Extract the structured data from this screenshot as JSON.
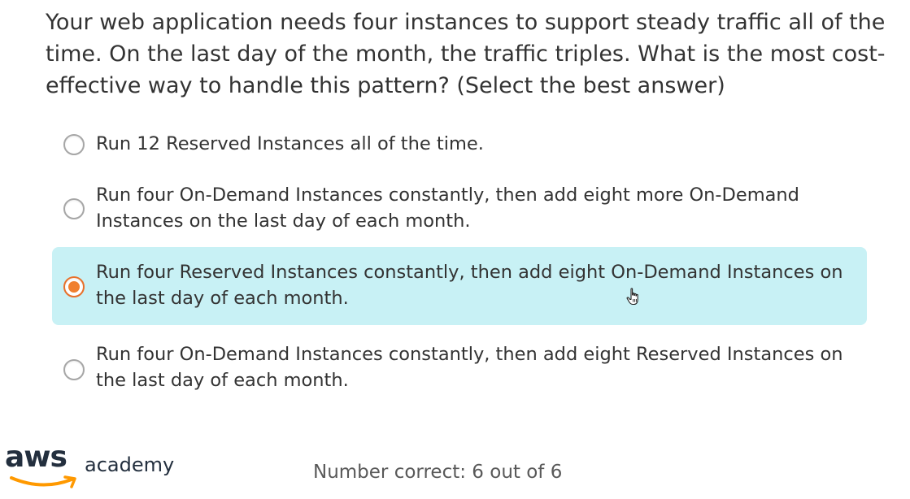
{
  "question": {
    "text": "Your web application needs four instances to support steady traffic all of the time. On the last day of the month, the traffic triples. What is the most cost-effective way to handle this pattern? (Select the best answer)"
  },
  "options": [
    {
      "label": "Run 12 Reserved Instances all of the time.",
      "selected": false
    },
    {
      "label": "Run four On-Demand Instances constantly, then add eight more On-Demand Instances on the last day of each month.",
      "selected": false
    },
    {
      "label": "Run four Reserved Instances constantly, then add eight On-Demand Instances on the last day of each month.",
      "selected": true
    },
    {
      "label": "Run four On-Demand Instances constantly, then add eight Reserved Instances on the last day of each month.",
      "selected": false
    }
  ],
  "footer": {
    "logo_word": "aws",
    "logo_sub": "academy",
    "score_text": "Number correct: 6 out of 6"
  },
  "colors": {
    "selected_background": "#c8f1f5",
    "radio_selected": "#f08030",
    "aws_orange": "#ff9900",
    "aws_navy": "#232f3e"
  },
  "icons": {
    "cursor": "hand-pointer-icon",
    "logo": "aws-smile-logo-icon"
  }
}
